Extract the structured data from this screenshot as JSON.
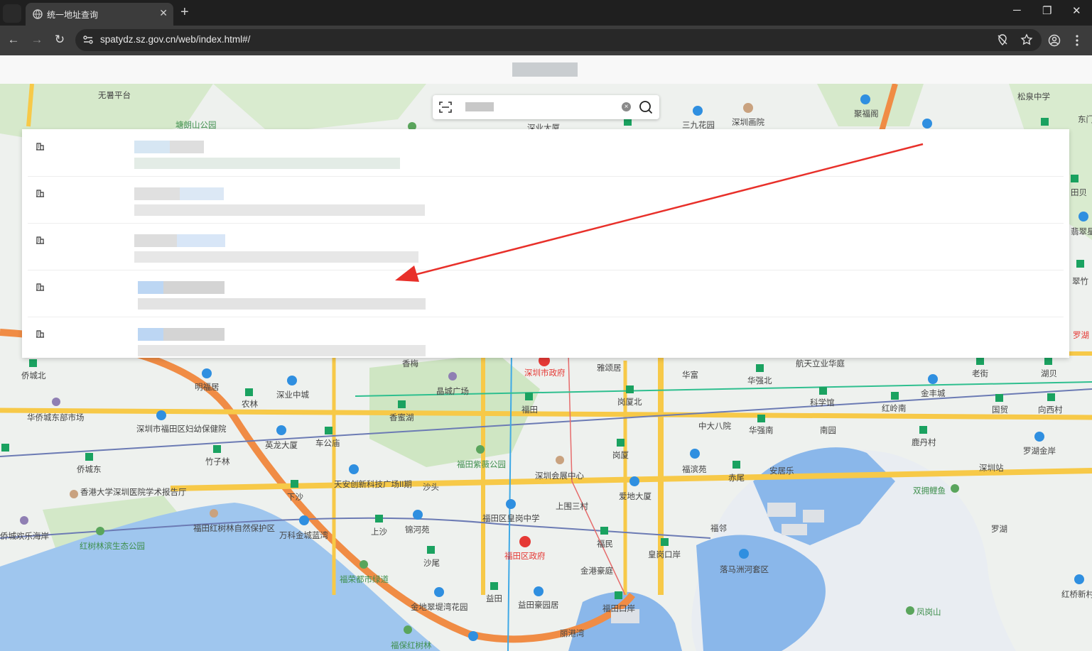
{
  "browser": {
    "tab_title": "统一地址查询",
    "new_tab": "+",
    "url": "spatydz.sz.gov.cn/web/index.html#/",
    "window_controls": {
      "minimize": "─",
      "restore": "❐",
      "close": "✕"
    },
    "nav": {
      "back": "←",
      "forward": "→",
      "reload": "↻"
    }
  },
  "search": {
    "clear_glyph": "×"
  },
  "results": [
    {
      "icon": "building-icon"
    },
    {
      "icon": "building-icon"
    },
    {
      "icon": "building-icon"
    },
    {
      "icon": "building-icon"
    },
    {
      "icon": "building-icon"
    }
  ],
  "map_labels": [
    {
      "text": "无暑平台",
      "style": ""
    },
    {
      "text": "塘朗山公园",
      "style": "green"
    },
    {
      "text": "深圳画院",
      "style": ""
    },
    {
      "text": "三九花园",
      "style": ""
    },
    {
      "text": "聚福阁",
      "style": ""
    },
    {
      "text": "松泉中学",
      "style": ""
    },
    {
      "text": "深业大厦",
      "style": ""
    },
    {
      "text": "侨城北",
      "style": ""
    },
    {
      "text": "明福居",
      "style": ""
    },
    {
      "text": "深业中城",
      "style": ""
    },
    {
      "text": "农林",
      "style": ""
    },
    {
      "text": "香梅",
      "style": ""
    },
    {
      "text": "晶城广场",
      "style": ""
    },
    {
      "text": "深圳市政府",
      "style": "red"
    },
    {
      "text": "雅颂居",
      "style": ""
    },
    {
      "text": "华富",
      "style": ""
    },
    {
      "text": "航天立业华庭",
      "style": ""
    },
    {
      "text": "华强北",
      "style": ""
    },
    {
      "text": "老街",
      "style": ""
    },
    {
      "text": "湖贝",
      "style": ""
    },
    {
      "text": "华侨城东部市场",
      "style": ""
    },
    {
      "text": "香蜜湖",
      "style": ""
    },
    {
      "text": "福田",
      "style": ""
    },
    {
      "text": "岗厦北",
      "style": ""
    },
    {
      "text": "科学馆",
      "style": ""
    },
    {
      "text": "红岭南",
      "style": ""
    },
    {
      "text": "金丰城",
      "style": ""
    },
    {
      "text": "国贸",
      "style": ""
    },
    {
      "text": "向西村",
      "style": ""
    },
    {
      "text": "深圳市福田区妇幼保健院",
      "style": ""
    },
    {
      "text": "英龙大厦",
      "style": ""
    },
    {
      "text": "车公庙",
      "style": ""
    },
    {
      "text": "中大八院",
      "style": ""
    },
    {
      "text": "华强南",
      "style": ""
    },
    {
      "text": "南园",
      "style": ""
    },
    {
      "text": "鹿丹村",
      "style": ""
    },
    {
      "text": "罗湖金岸",
      "style": ""
    },
    {
      "text": "侨城东",
      "style": ""
    },
    {
      "text": "竹子林",
      "style": ""
    },
    {
      "text": "福田紫薇公园",
      "style": "green"
    },
    {
      "text": "岗厦",
      "style": ""
    },
    {
      "text": "福滨苑",
      "style": ""
    },
    {
      "text": "深圳会展中心",
      "style": ""
    },
    {
      "text": "安居乐",
      "style": ""
    },
    {
      "text": "深圳站",
      "style": ""
    },
    {
      "text": "香港大学深圳医院学术报告厅",
      "style": ""
    },
    {
      "text": "天安创新科技广场II期",
      "style": ""
    },
    {
      "text": "沙头",
      "style": ""
    },
    {
      "text": "赤尾",
      "style": ""
    },
    {
      "text": "双拥鲤鱼",
      "style": "green"
    },
    {
      "text": "下沙",
      "style": ""
    },
    {
      "text": "上围三村",
      "style": ""
    },
    {
      "text": "爱地大厦",
      "style": ""
    },
    {
      "text": "罗湖",
      "style": ""
    },
    {
      "text": "侨城欢乐海岸",
      "style": ""
    },
    {
      "text": "福田红树林自然保护区",
      "style": ""
    },
    {
      "text": "万科金城蓝湾",
      "style": ""
    },
    {
      "text": "上沙",
      "style": ""
    },
    {
      "text": "锦河苑",
      "style": ""
    },
    {
      "text": "福田区皇岗中学",
      "style": ""
    },
    {
      "text": "福邻",
      "style": ""
    },
    {
      "text": "红树林滨生态公园",
      "style": "green"
    },
    {
      "text": "福田区政府",
      "style": "red"
    },
    {
      "text": "福民",
      "style": ""
    },
    {
      "text": "皇岗口岸",
      "style": ""
    },
    {
      "text": "落马洲河套区",
      "style": ""
    },
    {
      "text": "沙尾",
      "style": ""
    },
    {
      "text": "金港豪庭",
      "style": ""
    },
    {
      "text": "福荣都市绿道",
      "style": "green"
    },
    {
      "text": "益田",
      "style": ""
    },
    {
      "text": "金地翠堤湾花园",
      "style": ""
    },
    {
      "text": "益田豪园居",
      "style": ""
    },
    {
      "text": "福田口岸",
      "style": ""
    },
    {
      "text": "凤岗山",
      "style": "green"
    },
    {
      "text": "丽港湾",
      "style": ""
    },
    {
      "text": "福保红树林",
      "style": "green"
    },
    {
      "text": "红桥新村",
      "style": ""
    },
    {
      "text": "罗湖",
      "style": "red"
    },
    {
      "text": "翠竹",
      "style": ""
    },
    {
      "text": "田贝",
      "style": ""
    },
    {
      "text": "翡翠星",
      "style": ""
    },
    {
      "text": "东门",
      "style": ""
    }
  ]
}
